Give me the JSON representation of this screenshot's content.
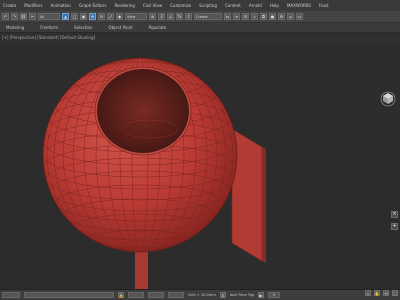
{
  "menubar": {
    "items": [
      "Create",
      "Modifiers",
      "Animation",
      "Graph Editors",
      "Rendering",
      "Civil View",
      "Customize",
      "Scripting",
      "Content",
      "Arnold",
      "Help",
      "MAXWORKS",
      "Frost"
    ]
  },
  "toolbar": {
    "selection_filter": "All",
    "named_selection": "Create Selection Set",
    "view_dropdown": "View"
  },
  "ribbon": {
    "tabs": [
      "Modeling",
      "Freeform",
      "Selection",
      "Object Paint",
      "Populate"
    ]
  },
  "viewport": {
    "label": "[+] [Perspective] [Standard] [Default Shading]"
  },
  "statusbar": {
    "grid_label": "Grid = 10.0mm",
    "add_time_tag": "Add Time Tag",
    "frame_counter": "0"
  },
  "colors": {
    "object_red": "#c8463d",
    "background": "#2c2c2c",
    "accent_blue": "#3d6fa8"
  },
  "icons": [
    "undo-icon",
    "redo-icon",
    "link-icon",
    "unlink-icon",
    "select-icon",
    "move-icon",
    "rotate-icon",
    "scale-icon",
    "snap-icon",
    "render-icon",
    "viewcube-icon",
    "play-icon",
    "key-icon",
    "zoom-icon",
    "pan-icon",
    "orbit-icon"
  ]
}
